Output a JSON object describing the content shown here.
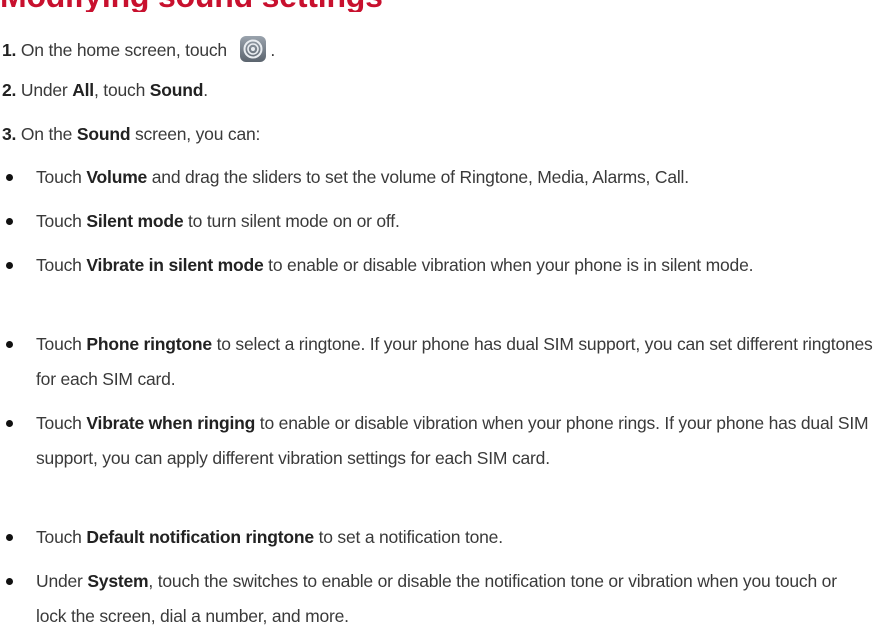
{
  "title": "Modifying sound settings",
  "steps": [
    {
      "num": "1.",
      "pre": "On the home screen, touch",
      "post": "."
    },
    {
      "num": "2.",
      "t1": "Under ",
      "b1": "All",
      "t2": ", touch ",
      "b2": "Sound",
      "t3": "."
    },
    {
      "num": "3.",
      "t1": "On the ",
      "b1": "Sound",
      "t2": " screen, you can:"
    }
  ],
  "icon": "settings-gear-icon",
  "bullets": [
    {
      "t1": "Touch ",
      "b1": "Volume",
      "t2": " and drag the sliders to set the volume of Ringtone, Media, Alarms, Call."
    },
    {
      "t1": "Touch ",
      "b1": "Silent mode",
      "t2": " to turn silent mode on or off."
    },
    {
      "t1": "Touch ",
      "b1": "Vibrate in silent mode",
      "t2": " to enable or disable vibration when your phone is in silent mode."
    },
    {
      "t1": "Touch ",
      "b1": "Phone ringtone",
      "t2": " to select a ringtone. If your phone has dual SIM support, you can set different ringtones for each SIM card."
    },
    {
      "t1": "Touch ",
      "b1": "Vibrate when ringing",
      "t2": " to enable or disable vibration when your phone rings. If your phone has dual SIM support, you can apply different vibration settings for each SIM card."
    },
    {
      "t1": "Touch ",
      "b1": "Default notification ringtone",
      "t2": " to set a notification tone."
    },
    {
      "t1": "Under ",
      "b1": "System",
      "t2": ", touch the switches to enable or disable the notification tone or vibration when you touch or lock the screen, dial a number, and more."
    }
  ]
}
